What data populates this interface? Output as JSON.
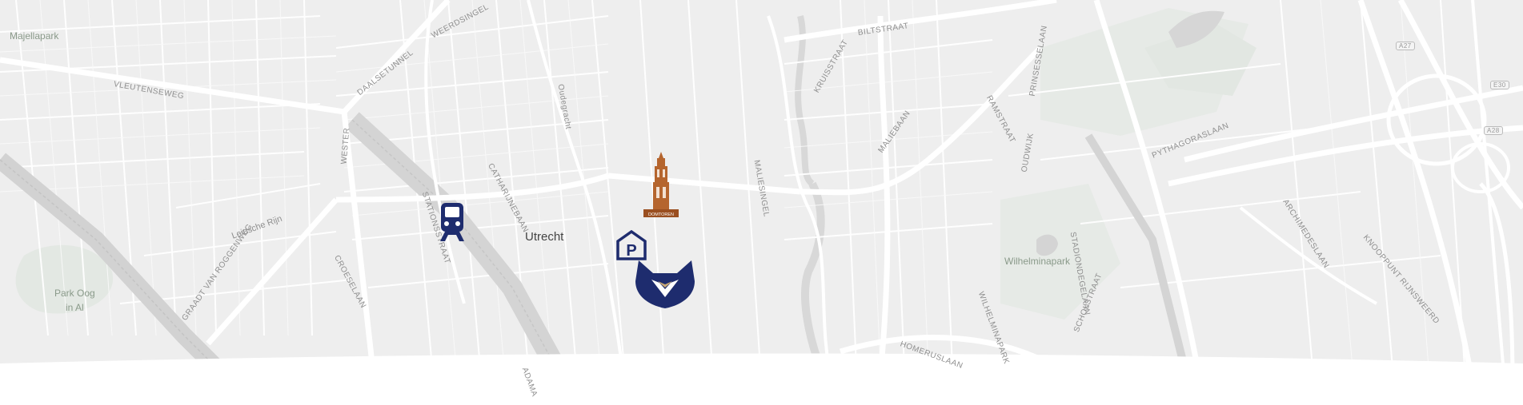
{
  "map": {
    "city_label": "Utrecht",
    "park_labels": [
      "Majellapark",
      "Park Oog",
      "in Al",
      "Wilhelminapark"
    ],
    "street_labels": [
      "VLEUTENSEWEG",
      "DAALSETUNNEL",
      "WEERDSINGEL",
      "BILTSTRAAT",
      "KRUISSTRAAT",
      "CATHARIJNEBAAN",
      "STATIONSSTRAAT",
      "Oudegracht",
      "Leidsche Rijn",
      "GRAADT VAN ROGGENWEG",
      "CROESELAAN",
      "MALIESINGEL",
      "MALIEBAAN",
      "RAMSTRAAT",
      "PRINSESSELAAN",
      "OUDWIJK",
      "STADIONDEGELAAN",
      "WILHELMINAPARK",
      "HOMERUSLAAN",
      "SCHOLSTRAAT",
      "PYTHAGORASLAAN",
      "ARCHIMEDESLAAN",
      "KNOOPPUNT RIJNSWEERD",
      "WESTER",
      "ADAMA"
    ],
    "road_shields": [
      "A27",
      "E30",
      "A28"
    ],
    "markers": [
      {
        "name": "train-station-icon",
        "color": "#1e2c6e"
      },
      {
        "name": "parking-icon",
        "color": "#1e2c6e",
        "letter": "P"
      },
      {
        "name": "domtoren-icon",
        "color": "#b5652e",
        "caption": "DOMTOREN"
      },
      {
        "name": "fox-logo-icon",
        "color": "#1e2c6e"
      }
    ]
  }
}
